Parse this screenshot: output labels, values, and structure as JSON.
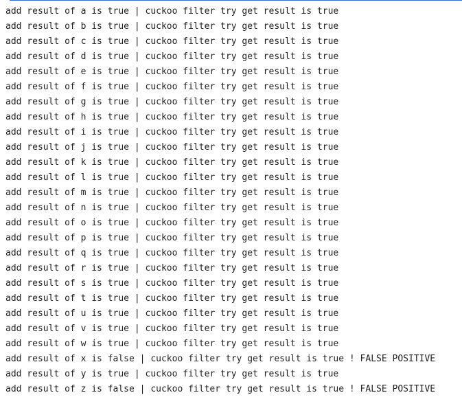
{
  "console": {
    "lines": [
      "add result of a is true | cuckoo filter try get result is true",
      "add result of b is true | cuckoo filter try get result is true",
      "add result of c is true | cuckoo filter try get result is true",
      "add result of d is true | cuckoo filter try get result is true",
      "add result of e is true | cuckoo filter try get result is true",
      "add result of f is true | cuckoo filter try get result is true",
      "add result of g is true | cuckoo filter try get result is true",
      "add result of h is true | cuckoo filter try get result is true",
      "add result of i is true | cuckoo filter try get result is true",
      "add result of j is true | cuckoo filter try get result is true",
      "add result of k is true | cuckoo filter try get result is true",
      "add result of l is true | cuckoo filter try get result is true",
      "add result of m is true | cuckoo filter try get result is true",
      "add result of n is true | cuckoo filter try get result is true",
      "add result of o is true | cuckoo filter try get result is true",
      "add result of p is true | cuckoo filter try get result is true",
      "add result of q is true | cuckoo filter try get result is true",
      "add result of r is true | cuckoo filter try get result is true",
      "add result of s is true | cuckoo filter try get result is true",
      "add result of t is true | cuckoo filter try get result is true",
      "add result of u is true | cuckoo filter try get result is true",
      "add result of v is true | cuckoo filter try get result is true",
      "add result of w is true | cuckoo filter try get result is true",
      "add result of x is false | cuckoo filter try get result is true ! FALSE POSITIVE",
      "add result of y is true | cuckoo filter try get result is true",
      "add result of z is false | cuckoo filter try get result is true ! FALSE POSITIVE"
    ]
  }
}
